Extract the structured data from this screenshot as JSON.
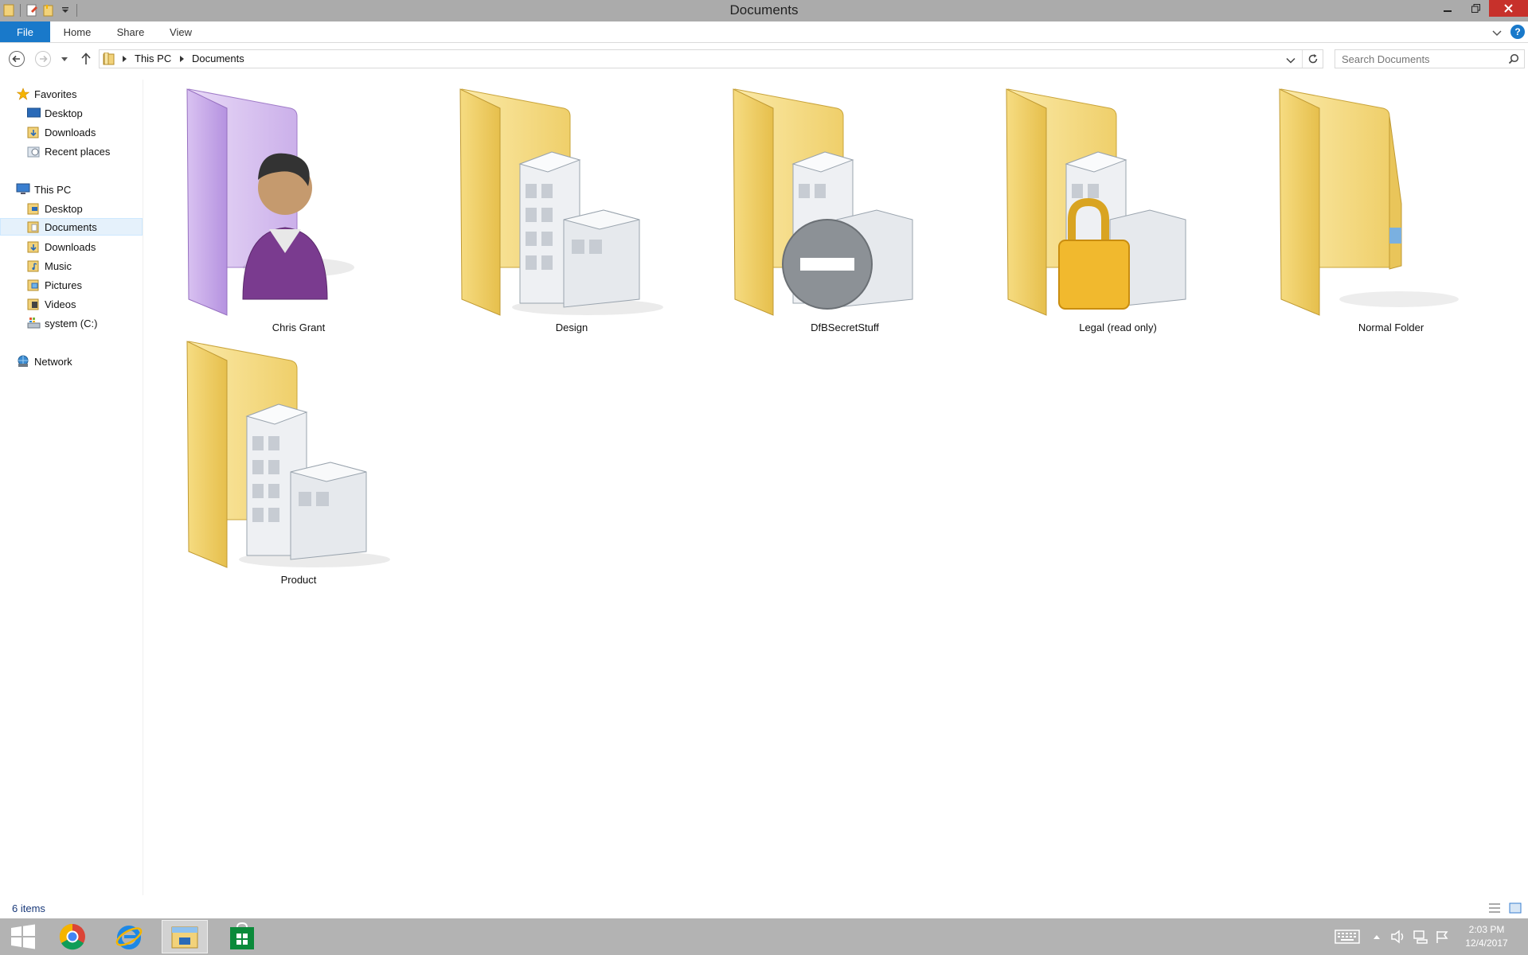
{
  "window": {
    "title": "Documents",
    "quick_access_icons": [
      "properties-icon",
      "new-folder-icon",
      "customize-qat-icon"
    ],
    "controls": [
      "minimize",
      "restore",
      "close"
    ]
  },
  "ribbon": {
    "tabs": [
      {
        "label": "File",
        "active": true
      },
      {
        "label": "Home"
      },
      {
        "label": "Share"
      },
      {
        "label": "View"
      }
    ],
    "help_glyph": "?"
  },
  "address": {
    "breadcrumb": [
      "This PC",
      "Documents"
    ],
    "search_placeholder": "Search Documents"
  },
  "navigation": {
    "favorites": {
      "label": "Favorites",
      "items": [
        "Desktop",
        "Downloads",
        "Recent places"
      ]
    },
    "this_pc": {
      "label": "This PC",
      "items": [
        "Desktop",
        "Documents",
        "Downloads",
        "Music",
        "Pictures",
        "Videos",
        "system (C:)"
      ],
      "selected": "Documents"
    },
    "network": {
      "label": "Network"
    }
  },
  "items": [
    {
      "name": "Chris Grant",
      "kind": "user-folder"
    },
    {
      "name": "Design",
      "kind": "shared-folder"
    },
    {
      "name": "DfBSecretStuff",
      "kind": "blocked-folder"
    },
    {
      "name": "Legal (read only)",
      "kind": "locked-folder"
    },
    {
      "name": "Normal Folder",
      "kind": "folder"
    },
    {
      "name": "Product",
      "kind": "shared-folder"
    }
  ],
  "status": {
    "item_count": "6 items"
  },
  "taskbar": {
    "apps": [
      "start",
      "chrome",
      "internet-explorer",
      "file-explorer",
      "store"
    ],
    "active_app": "file-explorer",
    "clock": {
      "time": "2:03 PM",
      "date": "12/4/2017"
    }
  },
  "colors": {
    "file_tab": "#1979ca",
    "close_button": "#c7312b",
    "title_bar": "#ababab",
    "taskbar": "#b3b3b3",
    "selection": "#e5f1fb",
    "folder_yellow": "#f3d57a",
    "folder_purple": "#d8c2ee"
  }
}
